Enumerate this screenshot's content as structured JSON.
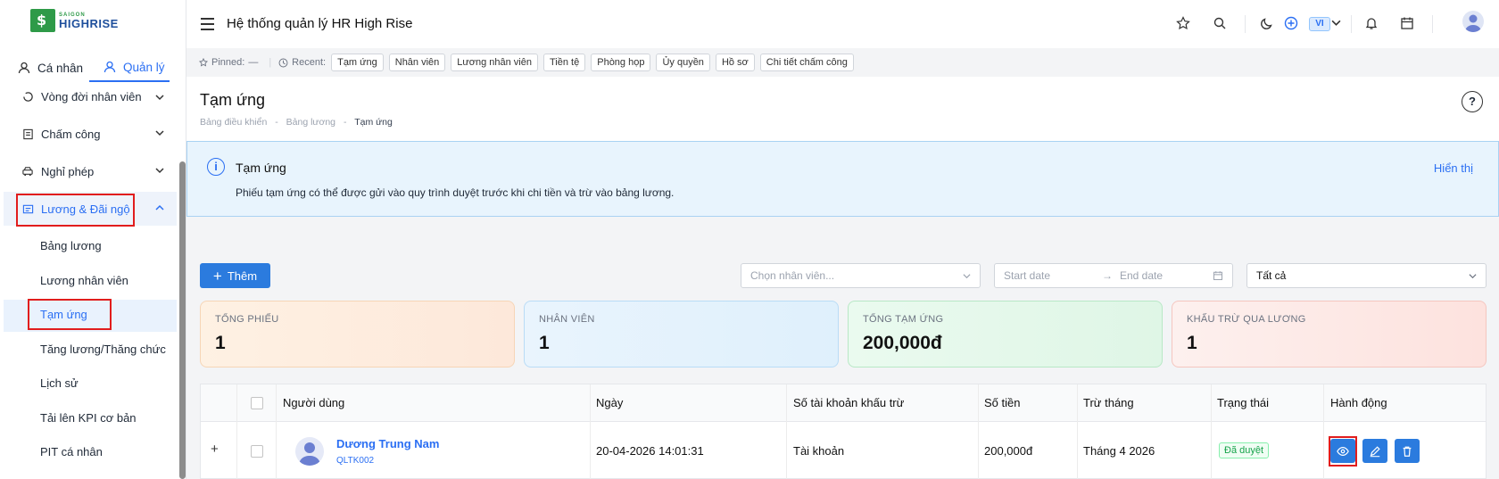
{
  "logo": {
    "small": "SAIGON",
    "big": "HIGHRISE"
  },
  "sidebar": {
    "tabs": [
      {
        "label": "Cá nhân"
      },
      {
        "label": "Quản lý"
      }
    ],
    "items": [
      {
        "label": "Vòng đời nhân viên"
      },
      {
        "label": "Chấm công"
      },
      {
        "label": "Nghỉ phép"
      },
      {
        "label": "Lương & Đãi ngộ"
      }
    ],
    "sub_items": [
      {
        "label": "Bảng lương"
      },
      {
        "label": "Lương nhân viên"
      },
      {
        "label": "Tạm ứng"
      },
      {
        "label": "Tăng lương/Thăng chức"
      },
      {
        "label": "Lịch sử"
      },
      {
        "label": "Tải lên KPI cơ bản"
      },
      {
        "label": "PIT cá nhân"
      }
    ]
  },
  "header": {
    "title": "Hệ thống quản lý HR High Rise",
    "lang": "VI"
  },
  "pinbar": {
    "pinned_label": "Pinned:",
    "pinned_value": "—",
    "recent_label": "Recent:",
    "chips": [
      "Tạm ứng",
      "Nhân viên",
      "Lương nhân viên",
      "Tiền tệ",
      "Phòng họp",
      "Ủy quyền",
      "Hồ sơ",
      "Chi tiết chấm công"
    ]
  },
  "page": {
    "title": "Tạm ứng",
    "breadcrumb": [
      "Bảng điều khiển",
      "Bảng lương",
      "Tạm ứng"
    ]
  },
  "banner": {
    "title": "Tạm ứng",
    "description": "Phiếu tạm ứng có thể được gửi vào quy trình duyệt trước khi chi tiền và trừ vào bảng lương.",
    "link": "Hiển thị"
  },
  "toolbar": {
    "add_label": "Thêm",
    "employee_placeholder": "Chọn nhân viên...",
    "start_date": "Start date",
    "end_date": "End date",
    "status_value": "Tất cả"
  },
  "stats": [
    {
      "label": "TỔNG PHIẾU",
      "value": "1"
    },
    {
      "label": "NHÂN VIÊN",
      "value": "1"
    },
    {
      "label": "TỔNG TẠM ỨNG",
      "value": "200,000đ"
    },
    {
      "label": "KHẤU TRỪ QUA LƯƠNG",
      "value": "1"
    }
  ],
  "table": {
    "columns": [
      "Người dùng",
      "Ngày",
      "Số tài khoản khấu trừ",
      "Số tiền",
      "Trừ tháng",
      "Trạng thái",
      "Hành động"
    ],
    "rows": [
      {
        "name": "Dương Trung Nam",
        "code": "QLTK002",
        "date": "20-04-2026 14:01:31",
        "account": "Tài khoản",
        "amount": "200,000đ",
        "month": "Tháng 4 2026",
        "status": "Đã duyệt"
      }
    ],
    "expand_symbol": "+"
  },
  "colors": {
    "accent": "#2b7bde",
    "highlight": "#e11d1d",
    "success": "#16a34a"
  }
}
